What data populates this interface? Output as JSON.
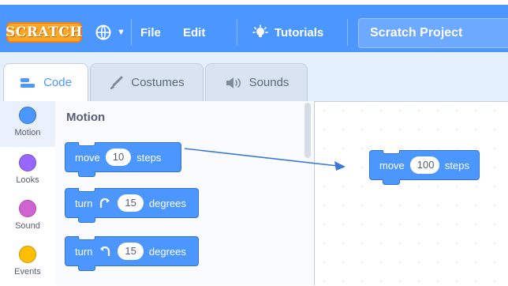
{
  "app": {
    "logo_text": "SCRATCH",
    "menu": {
      "file": "File",
      "edit": "Edit",
      "tutorials": "Tutorials"
    },
    "project_title": "Scratch Project"
  },
  "tabs": [
    {
      "label": "Code",
      "icon": "code-icon",
      "active": true
    },
    {
      "label": "Costumes",
      "icon": "brush-icon",
      "active": false
    },
    {
      "label": "Sounds",
      "icon": "speaker-icon",
      "active": false
    }
  ],
  "categories": [
    {
      "label": "Motion",
      "color": "#4c97ff",
      "active": true
    },
    {
      "label": "Looks",
      "color": "#9966ff",
      "active": false
    },
    {
      "label": "Sound",
      "color": "#cf63cf",
      "active": false
    },
    {
      "label": "Events",
      "color": "#ffbf00",
      "active": false
    }
  ],
  "palette": {
    "title": "Motion",
    "blocks": {
      "move": {
        "prefix": "move",
        "value": "10",
        "suffix": "steps"
      },
      "turn_right": {
        "prefix": "turn",
        "value": "15",
        "suffix": "degrees",
        "icon": "rotate-right-icon"
      },
      "turn_left": {
        "prefix": "turn",
        "value": "15",
        "suffix": "degrees",
        "icon": "rotate-left-icon"
      }
    }
  },
  "workspace": {
    "block": {
      "prefix": "move",
      "value": "100",
      "suffix": "steps"
    }
  },
  "colors": {
    "menubar": "#4c97ff",
    "motion": "#4c97ff",
    "looks": "#9966ff",
    "sound": "#cf63cf",
    "events": "#ffbf00"
  }
}
